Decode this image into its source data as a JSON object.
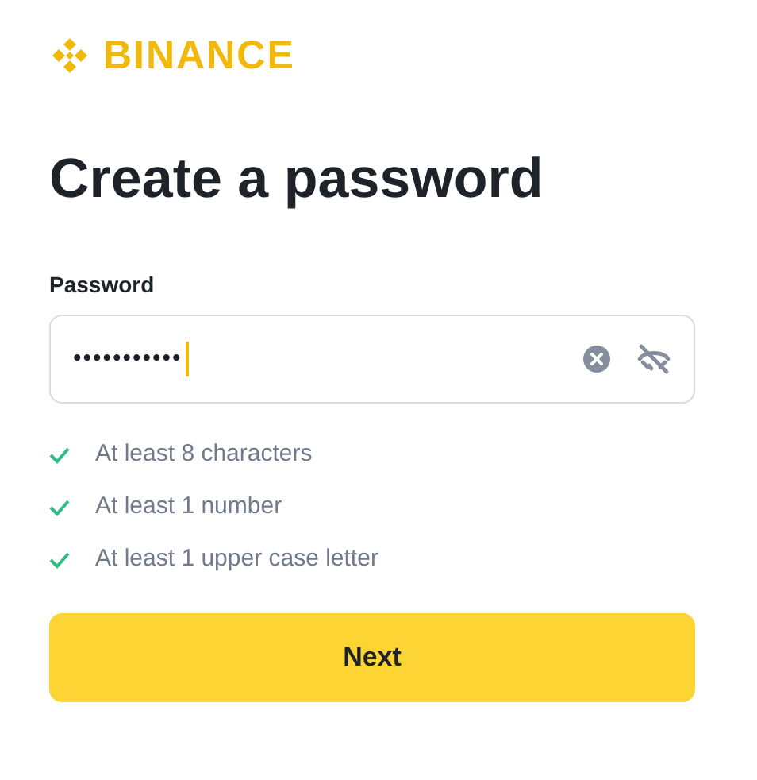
{
  "brand": "BINANCE",
  "title": "Create a password",
  "password": {
    "label": "Password",
    "value": "•••••••••••"
  },
  "requirements": [
    {
      "text": "At least 8 characters",
      "met": true
    },
    {
      "text": "At least 1 number",
      "met": true
    },
    {
      "text": "At least 1 upper case letter",
      "met": true
    }
  ],
  "next_button": "Next"
}
